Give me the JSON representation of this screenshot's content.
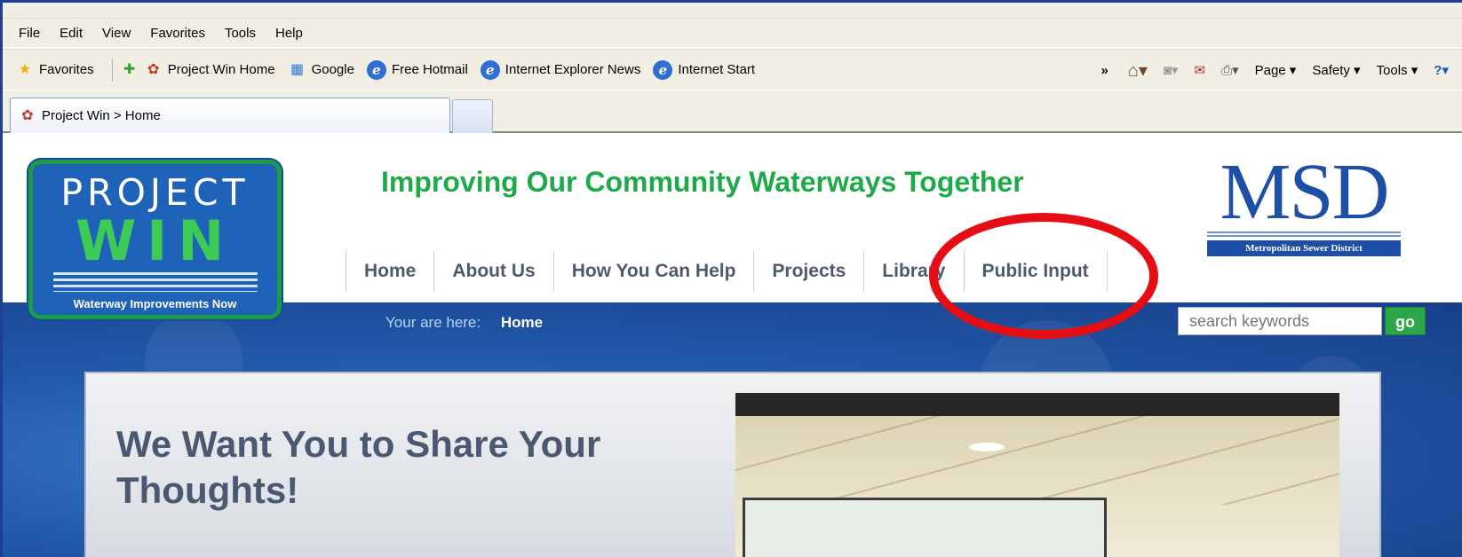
{
  "browser": {
    "menu": [
      "File",
      "Edit",
      "View",
      "Favorites",
      "Tools",
      "Help"
    ],
    "favorites_label": "Favorites",
    "links": [
      "Project Win Home",
      "Google",
      "Free Hotmail",
      "Internet Explorer News",
      "Internet Start"
    ],
    "overflow": "»",
    "right_tools": [
      "Page ▾",
      "Safety ▾",
      "Tools ▾"
    ],
    "tab_title": "Project Win > Home"
  },
  "site": {
    "logo": {
      "line1": "PROJECT",
      "line2": "WIN",
      "line3": "Waterway Improvements Now"
    },
    "tagline": "Improving Our Community Waterways Together",
    "msd": {
      "big": "MSD",
      "sub": "Metropolitan Sewer District"
    },
    "nav": [
      "Home",
      "About Us",
      "How You Can Help",
      "Projects",
      "Library",
      "Public Input"
    ],
    "breadcrumb": {
      "label": "Your are here:",
      "current": "Home"
    },
    "search": {
      "placeholder": "search keywords",
      "button": "go"
    },
    "panel_title": "We Want You to Share Your Thoughts!",
    "highlight_color": "#e40e14"
  }
}
